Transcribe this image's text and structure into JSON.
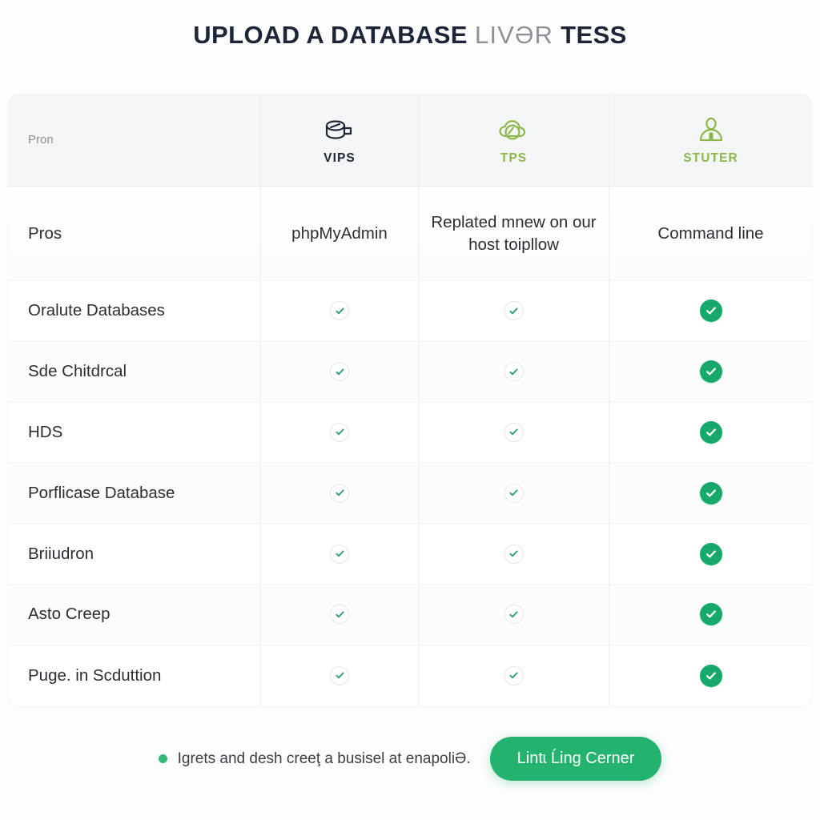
{
  "title": {
    "strong_1": "UPLOAD A DATABASE",
    "light": "LIVƏR",
    "strong_2": "TESS"
  },
  "colors": {
    "title_dark": "#1c2638",
    "title_light": "#8d9199",
    "header_green": "#8cb84b",
    "check_solid_green": "#16a96b",
    "cta_green": "#23b36f",
    "bullet_green": "#34b87c",
    "card_header_bg": "#f4f5f6",
    "page_bg": "#fdfdfd"
  },
  "table": {
    "columns": [
      {
        "label": "Pron",
        "icon": "",
        "type": "label"
      },
      {
        "label": "VIPS",
        "icon": "database-icon",
        "type": "product"
      },
      {
        "label": "TPS",
        "icon": "cloud-icon",
        "type": "product"
      },
      {
        "label": "STUTER",
        "icon": "user-icon",
        "type": "product"
      }
    ],
    "description_row": {
      "label": "Pros",
      "values": [
        "phpMyAdmin",
        "Replated mnew on our host toipllow",
        "Command line"
      ]
    },
    "rows": [
      {
        "label": "Oralute Databases",
        "marks": [
          "outline",
          "outline",
          "solid"
        ]
      },
      {
        "label": "Sde Chitdrcal",
        "marks": [
          "outline",
          "outline",
          "solid"
        ]
      },
      {
        "label": "HDS",
        "marks": [
          "outline",
          "outline",
          "solid"
        ]
      },
      {
        "label": "Porflicase Database",
        "marks": [
          "outline",
          "outline",
          "solid"
        ]
      },
      {
        "label": "Briiudron",
        "marks": [
          "outline",
          "outline",
          "solid"
        ]
      },
      {
        "label": "Asto Creep",
        "marks": [
          "outline",
          "outline",
          "solid"
        ]
      },
      {
        "label": "Puge. in Scduttion",
        "marks": [
          "outline",
          "outline",
          "solid"
        ]
      }
    ]
  },
  "footer": {
    "note": "Igrets and desh creeţ a busisel at enapoliƏ.",
    "cta_label": "Lintɩ Ĺing Cerner"
  }
}
